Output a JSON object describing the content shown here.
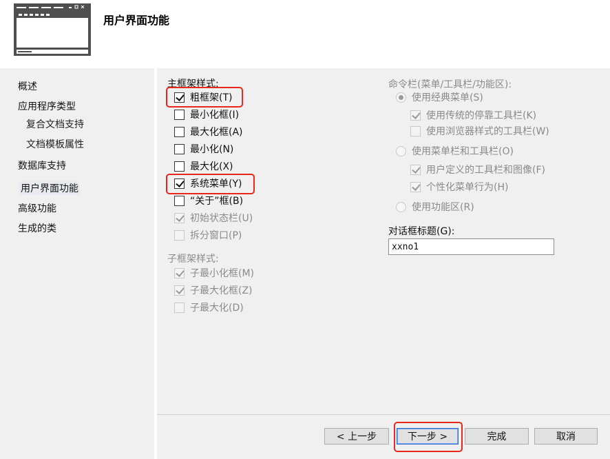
{
  "header": {
    "title": "用户界面功能",
    "icon": "window-app-icon"
  },
  "sidebar": {
    "items": [
      {
        "label": "概述"
      },
      {
        "label": "应用程序类型"
      },
      {
        "label": "复合文档支持"
      },
      {
        "label": "文档模板属性"
      },
      {
        "label": "数据库支持"
      },
      {
        "label": "用户界面功能"
      },
      {
        "label": "高级功能"
      },
      {
        "label": "生成的类"
      }
    ],
    "active_index": 5
  },
  "main_frame": {
    "label": "主框架样式:",
    "options": [
      {
        "label": "粗框架(T)",
        "checked": true,
        "enabled": true
      },
      {
        "label": "最小化框(I)",
        "checked": false,
        "enabled": true
      },
      {
        "label": "最大化框(A)",
        "checked": false,
        "enabled": true
      },
      {
        "label": "最小化(N)",
        "checked": false,
        "enabled": true
      },
      {
        "label": "最大化(X)",
        "checked": false,
        "enabled": true
      },
      {
        "label": "系统菜单(Y)",
        "checked": true,
        "enabled": true
      },
      {
        "label": "“关于”框(B)",
        "checked": false,
        "enabled": true
      },
      {
        "label": "初始状态栏(U)",
        "checked": true,
        "enabled": false
      },
      {
        "label": "拆分窗口(P)",
        "checked": false,
        "enabled": false
      }
    ]
  },
  "child_frame": {
    "label": "子框架样式:",
    "options": [
      {
        "label": "子最小化框(M)",
        "checked": true,
        "enabled": false
      },
      {
        "label": "子最大化框(Z)",
        "checked": true,
        "enabled": false
      },
      {
        "label": "子最大化(D)",
        "checked": false,
        "enabled": false
      }
    ]
  },
  "command_bar": {
    "label": "命令栏(菜单/工具栏/功能区):",
    "radio_classic": {
      "label": "使用经典菜单(S)",
      "selected": true
    },
    "classic_options": [
      {
        "label": "使用传统的停靠工具栏(K)",
        "checked": true
      },
      {
        "label": "使用浏览器样式的工具栏(W)",
        "checked": false
      }
    ],
    "radio_menubar": {
      "label": "使用菜单栏和工具栏(O)",
      "selected": false
    },
    "menubar_options": [
      {
        "label": "用户定义的工具栏和图像(F)",
        "checked": true
      },
      {
        "label": "个性化菜单行为(H)",
        "checked": true
      }
    ],
    "radio_ribbon": {
      "label": "使用功能区(R)",
      "selected": false
    }
  },
  "dialog_title": {
    "label": "对话框标题(G):",
    "value": "xxno1"
  },
  "footer": {
    "back_label": "< 上一步",
    "next_label": "下一步 >",
    "finish_label": "完成",
    "cancel_label": "取消"
  },
  "colors": {
    "highlight": "#e8271a",
    "panel": "#f0f0f0",
    "disabled_text": "#8a8a8a"
  }
}
